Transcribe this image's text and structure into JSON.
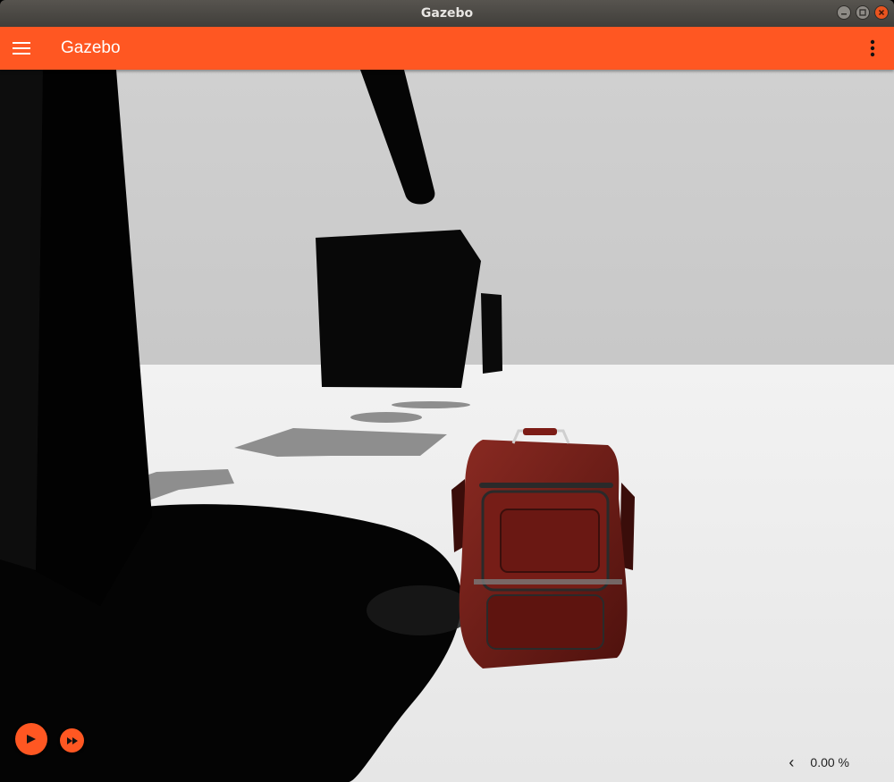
{
  "window": {
    "title": "Gazebo"
  },
  "toolbar": {
    "title": "Gazebo",
    "menu_icon": "hamburger-menu-icon",
    "more_icon": "vertical-dots-icon"
  },
  "playback": {
    "play_icon": "play-icon",
    "step_icon": "fast-forward-icon"
  },
  "stats": {
    "expand_icon": "chevron-left-icon",
    "expand_glyph": "‹",
    "rtf": "0.00 %"
  },
  "theme": {
    "accent": "#ff5722",
    "titlebar": "#4a4843",
    "sky": "#cbcbcb",
    "ground": "#ececec",
    "backpack": "#6e1914"
  }
}
